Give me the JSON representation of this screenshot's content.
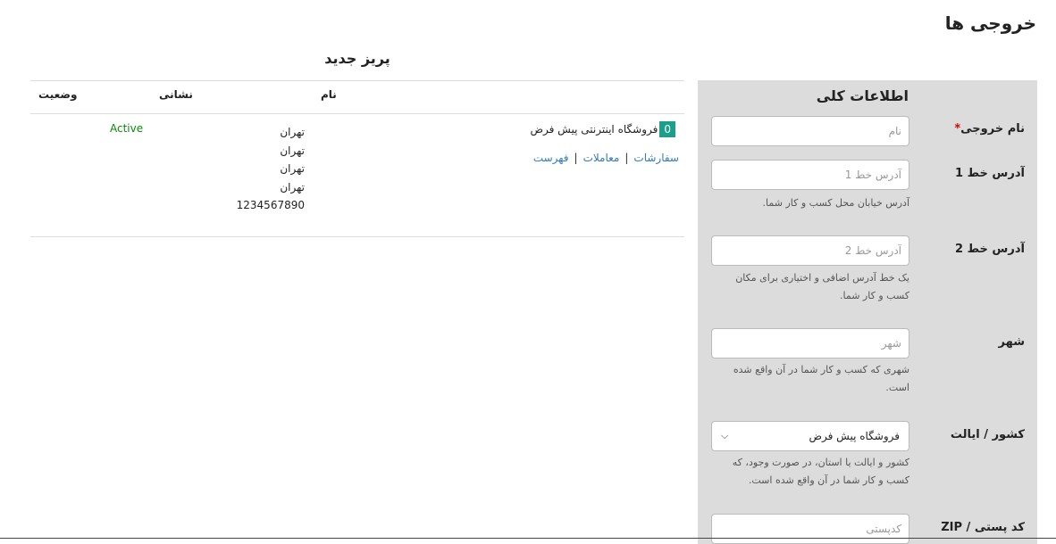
{
  "page": {
    "title": "خروجی ها"
  },
  "table": {
    "heading": "پریز جدید",
    "columns": {
      "name": "نام",
      "address": "نشانی",
      "status": "وضعیت"
    },
    "rows": [
      {
        "id": "0",
        "name": "فروشگاه اینترنتی پیش فرض",
        "links": {
          "orders": "سفارشات",
          "transactions": "معاملات",
          "list": "فهرست"
        },
        "address_lines": [
          "تهران",
          "تهران",
          "تهران",
          "تهران",
          "1234567890"
        ],
        "status": "Active"
      }
    ]
  },
  "form": {
    "heading": "اطلاعات کلی",
    "name": {
      "label": "نام خروجی",
      "required": "*",
      "placeholder": "نام"
    },
    "address1": {
      "label": "آدرس خط 1",
      "placeholder": "آدرس خط 1",
      "help": "آدرس خیابان محل کسب و کار شما."
    },
    "address2": {
      "label": "آدرس خط 2",
      "placeholder": "آدرس خط 2",
      "help": "یک خط آدرس اضافی و اختیاری برای مکان کسب و کار شما."
    },
    "city": {
      "label": "شهر",
      "placeholder": "شهر",
      "help": "شهری که کسب و کار شما در آن واقع شده است."
    },
    "state": {
      "label": "کشور / ایالت",
      "value": "فروشگاه پیش فرض",
      "help": "کشور و ایالت یا استان، در صورت وجود، که کسب و کار شما در آن واقع شده است."
    },
    "zip": {
      "label": "کد پستی / ZIP",
      "placeholder": "کدپستی"
    }
  }
}
